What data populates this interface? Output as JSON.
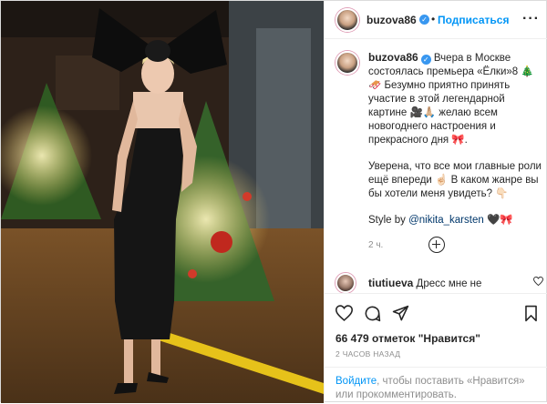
{
  "post": {
    "username": "buzova86",
    "verified_icon": "verified-badge-icon",
    "follow_label": "Подписаться",
    "more_icon": "more-options-icon",
    "caption": {
      "p1": "Вчера в Москве состоялась премьера «Ёлки»8 🎄🛷 Безумно приятно принять участие в этой легендарной картине 🎥🙏🏼 желаю всем новогоднего настроения и прекрасного дня 🎀.",
      "p2": "Уверена, что все мои главные роли ещё впереди ☝🏻 В каком жанре вы бы хотели меня увидеть? 👇🏻",
      "style_prefix": "Style by ",
      "style_mention": "@nikita_karsten",
      "style_suffix": " 🖤🎀",
      "time": "2 ч."
    },
    "load_more_icon": "plus-circle-icon",
    "comment": {
      "username": "tiutiueva",
      "text": "Дресс мне не"
    },
    "likes": "66 479 отметок \"Нравится\"",
    "posted_ago": "2 ЧАСОВ НАЗАД",
    "login_link": "Войдите",
    "login_text": ", чтобы поставить «Нравится» или прокомментировать.",
    "accent_color": "#0095f6"
  }
}
